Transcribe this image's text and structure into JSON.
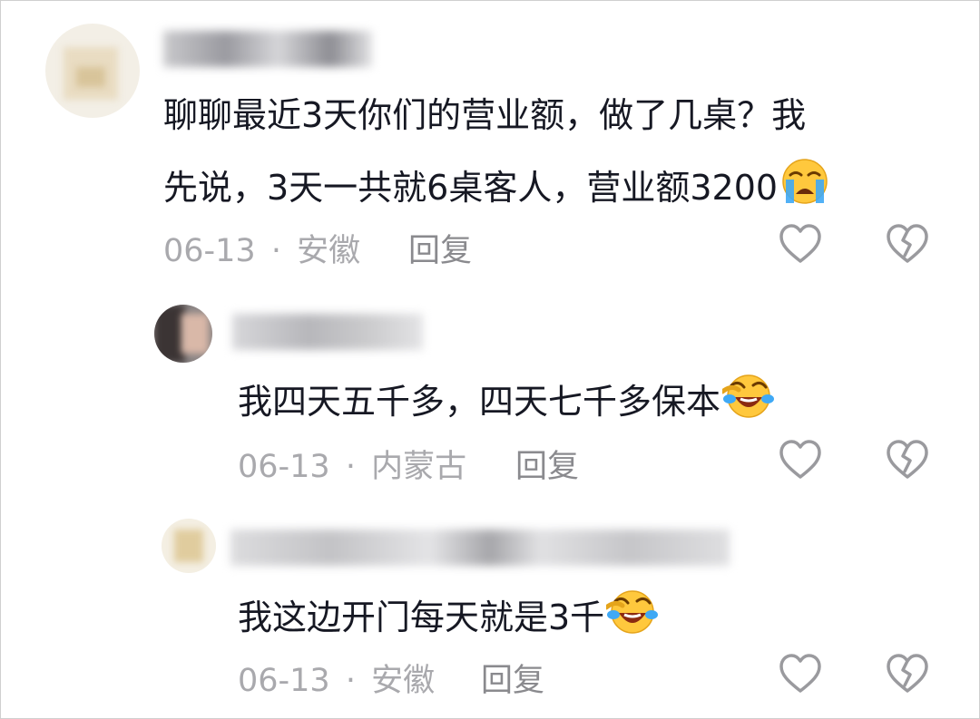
{
  "comments": [
    {
      "text_line1": "聊聊最近3天你们的营业额，做了几桌？我",
      "text_line2": "先说，3天一共就6桌客人，营业额3200",
      "emoji": "loudly-crying-emoji",
      "date": "06-13",
      "sep": "·",
      "location": "安徽",
      "reply_label": "回复"
    },
    {
      "text": "我四天五千多，四天七千多保本",
      "emoji": "rolling-laughing-emoji",
      "date": "06-13",
      "sep": "·",
      "location": "内蒙古",
      "reply_label": "回复"
    },
    {
      "text": "我这边开门每天就是3千",
      "emoji": "rolling-laughing-emoji",
      "date": "06-13",
      "sep": "·",
      "location": "安徽",
      "reply_label": "回复"
    }
  ],
  "icons": {
    "like": "heart-outline-icon",
    "dislike": "broken-heart-icon"
  },
  "colors": {
    "text": "#161823",
    "meta": "#a9a9ad",
    "icon": "#9a9a9e",
    "emoji_face": "#ffc83d",
    "emoji_tear": "#3fa9f5"
  }
}
